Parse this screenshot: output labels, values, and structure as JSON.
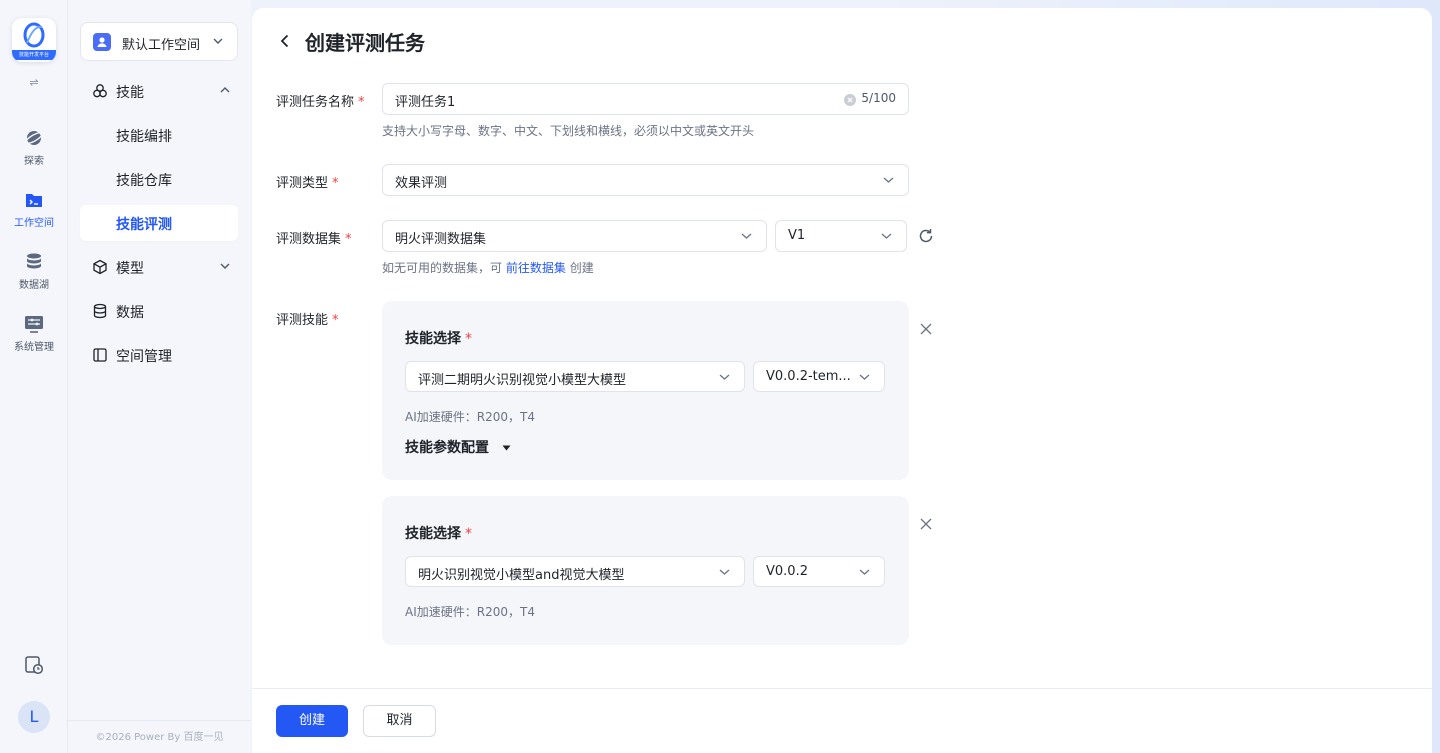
{
  "rail": {
    "logo_text": "技能开发平台",
    "items": [
      {
        "label": "探索",
        "icon": "planet-icon"
      },
      {
        "label": "工作空间",
        "icon": "folder-terminal-icon"
      },
      {
        "label": "数据湖",
        "icon": "database-icon"
      },
      {
        "label": "系统管理",
        "icon": "settings-panel-icon"
      }
    ],
    "avatar": "L"
  },
  "sidebar": {
    "workspace": "默认工作空间",
    "groups": [
      {
        "label": "技能",
        "expanded": true,
        "children": [
          "技能编排",
          "技能仓库",
          "技能评测"
        ]
      },
      {
        "label": "模型"
      },
      {
        "label": "数据"
      },
      {
        "label": "空间管理"
      }
    ],
    "active_child": "技能评测",
    "footer": "©2026 Power By 百度一见"
  },
  "page": {
    "title": "创建评测任务",
    "fields": {
      "name": {
        "label": "评测任务名称",
        "value": "评测任务1",
        "count": "5/100",
        "hint": "支持大小写字母、数字、中文、下划线和横线，必须以中文或英文开头"
      },
      "type": {
        "label": "评测类型",
        "value": "效果评测"
      },
      "dataset": {
        "label": "评测数据集",
        "value": "明火评测数据集",
        "version": "V1",
        "hint_prefix": "如无可用的数据集，可",
        "hint_link": "前往数据集",
        "hint_suffix": "创建"
      },
      "skill": {
        "label": "评测技能"
      }
    },
    "skill_cards": [
      {
        "title": "技能选择",
        "skill": "评测二期明火识别视觉小模型大模型",
        "version": "V0.0.2-tem...",
        "hardware": "AI加速硬件：R200，T4",
        "param_config": "技能参数配置"
      },
      {
        "title": "技能选择",
        "skill": "明火识别视觉小模型and视觉大模型",
        "version": "V0.0.2",
        "hardware": "AI加速硬件：R200，T4"
      }
    ],
    "buttons": {
      "create": "创建",
      "cancel": "取消"
    }
  },
  "colors": {
    "primary": "#2458f5",
    "required": "#f53f3f",
    "card_bg": "#f4f6fa"
  }
}
